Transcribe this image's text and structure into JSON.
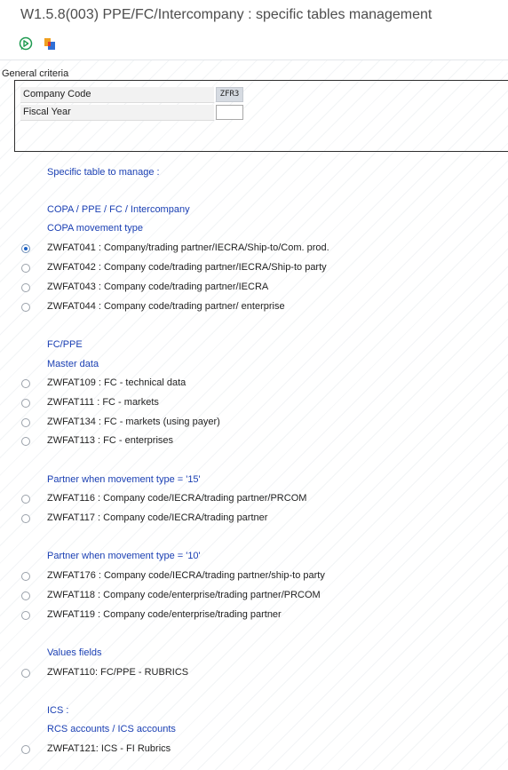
{
  "window": {
    "title": "W1.5.8(003) PPE/FC/Intercompany : specific tables management"
  },
  "toolbar": {
    "execute_icon": "execute-icon",
    "variant_icon": "get-variant-icon"
  },
  "general_criteria": {
    "header": "General criteria",
    "company_code": {
      "label": "Company Code",
      "value": "ZFR3"
    },
    "fiscal_year": {
      "label": "Fiscal Year",
      "value": ""
    }
  },
  "tables": {
    "heading": "Specific table to manage :",
    "copa": {
      "title": "COPA / PPE / FC / Intercompany",
      "subtitle": "COPA movement type",
      "options": [
        {
          "label": "ZWFAT041 : Company/trading partner/IECRA/Ship-to/Com. prod.",
          "selected": true
        },
        {
          "label": "ZWFAT042 : Company code/trading partner/IECRA/Ship-to party",
          "selected": false
        },
        {
          "label": "ZWFAT043 : Company code/trading partner/IECRA",
          "selected": false
        },
        {
          "label": "ZWFAT044 : Company code/trading partner/ enterprise",
          "selected": false
        }
      ]
    },
    "fcppe": {
      "title": "FC/PPE",
      "subtitle": "Master data",
      "options": [
        {
          "label": "ZWFAT109 : FC - technical data",
          "selected": false
        },
        {
          "label": "ZWFAT111 : FC - markets",
          "selected": false
        },
        {
          "label": "ZWFAT134 : FC - markets (using payer)",
          "selected": false
        },
        {
          "label": "ZWFAT113 : FC - enterprises",
          "selected": false
        }
      ]
    },
    "partner15": {
      "title": "Partner when movement type = '15'",
      "options": [
        {
          "label": "ZWFAT116 : Company code/IECRA/trading partner/PRCOM",
          "selected": false
        },
        {
          "label": "ZWFAT117 : Company code/IECRA/trading partner",
          "selected": false
        }
      ]
    },
    "partner10": {
      "title": "Partner when movement type = '10'",
      "options": [
        {
          "label": "ZWFAT176 : Company code/IECRA/trading partner/ship-to party",
          "selected": false
        },
        {
          "label": "ZWFAT118 : Company code/enterprise/trading partner/PRCOM",
          "selected": false
        },
        {
          "label": "ZWFAT119 : Company code/enterprise/trading partner",
          "selected": false
        }
      ]
    },
    "values": {
      "title": "Values fields",
      "options": [
        {
          "label": "ZWFAT110: FC/PPE - RUBRICS",
          "selected": false
        }
      ]
    },
    "ics": {
      "title": "ICS :",
      "subtitle": "RCS accounts / ICS accounts",
      "options": [
        {
          "label": "ZWFAT121: ICS - FI Rubrics",
          "selected": false
        }
      ]
    }
  }
}
